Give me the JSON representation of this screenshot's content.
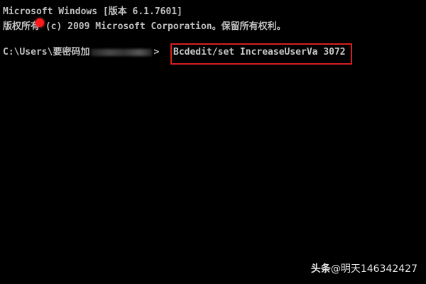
{
  "console": {
    "header_line": "Microsoft Windows [版本 6.1.7601]",
    "copyright_line": "版权所有 (c) 2009 Microsoft Corporation。保留所有权利。",
    "prompt_path": "C:\\Users\\要密码加",
    "prompt_symbol": ">",
    "command": "Bcdedit/set IncreaseUserVa 3072"
  },
  "colors": {
    "background": "#000000",
    "text": "#c0c0c0",
    "highlight_border": "#d81e1e",
    "cursor_dot": "#ff1a1a"
  },
  "watermark": {
    "brand": "头条",
    "handle": "@明天146342427"
  }
}
